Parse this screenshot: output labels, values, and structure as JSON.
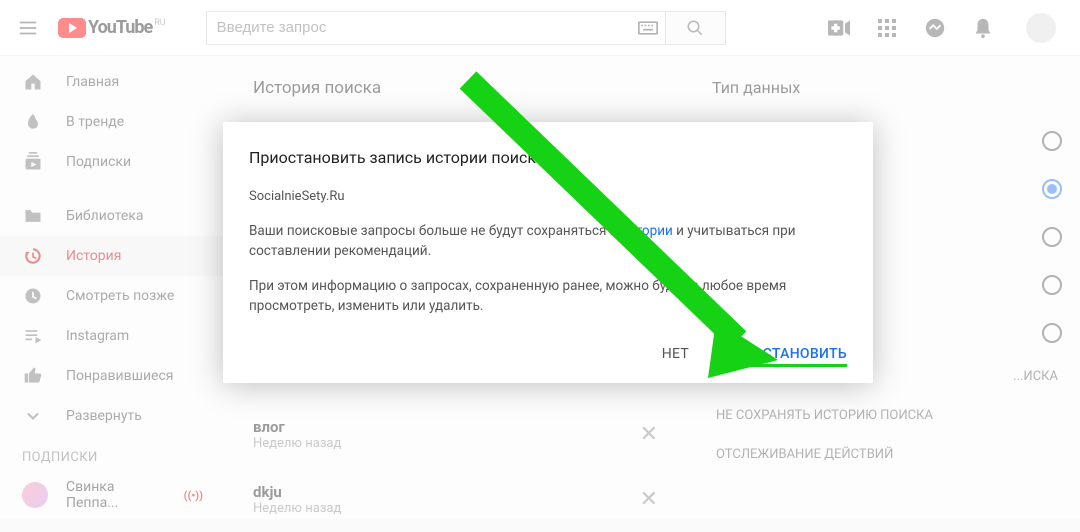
{
  "header": {
    "logo_text": "YouTube",
    "logo_region": "RU",
    "search_placeholder": "Введите запрос"
  },
  "sidebar": {
    "items": [
      {
        "icon": "home",
        "label": "Главная"
      },
      {
        "icon": "trend",
        "label": "В тренде"
      },
      {
        "icon": "subs",
        "label": "Подписки"
      }
    ],
    "items2": [
      {
        "icon": "lib",
        "label": "Библиотека"
      },
      {
        "icon": "hist",
        "label": "История",
        "active": true
      },
      {
        "icon": "later",
        "label": "Смотреть позже"
      },
      {
        "icon": "insta",
        "label": "Instagram"
      },
      {
        "icon": "like",
        "label": "Понравившиеся"
      },
      {
        "icon": "expand",
        "label": "Развернуть"
      }
    ],
    "subs_heading": "ПОДПИСКИ",
    "channels": [
      {
        "name": "Свинка Пеппа...",
        "live": "((•))"
      }
    ]
  },
  "mid": {
    "title": "История поиска",
    "rows": [
      {
        "t1": "влог",
        "t2": "Неделю назад"
      },
      {
        "t1": "dkju",
        "t2": "Неделю назад"
      }
    ]
  },
  "right": {
    "title": "Тип данных",
    "radios": [
      false,
      true,
      false,
      false,
      false
    ],
    "extra": [
      "...ИСКА",
      "НЕ СОХРАНЯТЬ ИСТОРИЮ ПОИСКА",
      "ОТСЛЕЖИВАНИЕ ДЕЙСТВИЙ"
    ]
  },
  "dialog": {
    "title": "Приостановить запись истории поиска?",
    "author": "SocialnieSety.Ru",
    "para1_a": "Ваши поисковые запросы больше не будут сохраняться в ",
    "para1_link": "истории",
    "para1_b": " и учитываться при составлении рекомендаций.",
    "para2": "При этом информацию о запросах, сохраненную ранее, можно будет в любое время просмотреть, изменить или удалить.",
    "btn_no": "НЕТ",
    "btn_yes": "ПРИОСТАНОВИТЬ"
  }
}
